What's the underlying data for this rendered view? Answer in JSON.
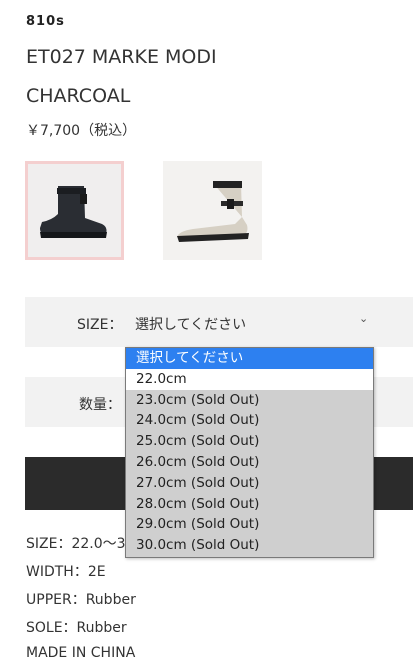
{
  "product": {
    "brand": "810s",
    "name_line1": "ET027 MARKE MODI",
    "name_line2": "CHARCOAL",
    "price": "￥7,700（税込）"
  },
  "thumbnails": [
    {
      "icon": "boot-charcoal-image",
      "color": "#2a2d33"
    },
    {
      "icon": "boot-beige-image",
      "color": "#d6d0c4"
    }
  ],
  "size_select": {
    "label": "SIZE：",
    "selected": "選択してください",
    "options": [
      "選択してください",
      "22.0cm",
      "23.0cm (Sold Out)",
      "24.0cm (Sold Out)",
      "25.0cm (Sold Out)",
      "26.0cm (Sold Out)",
      "27.0cm (Sold Out)",
      "28.0cm (Sold Out)",
      "29.0cm (Sold Out)",
      "30.0cm (Sold Out)"
    ]
  },
  "quantity": {
    "label": "数量："
  },
  "specs": {
    "size": "SIZE：22.0〜3",
    "width": "WIDTH：2E",
    "upper": "UPPER：Rubber",
    "sole": "SOLE：Rubber",
    "origin": "MADE IN CHINA"
  },
  "colors": {
    "highlight": "#2d80f0",
    "selected_border": "#f4cfcf",
    "button_bg": "#2b2b2b"
  }
}
